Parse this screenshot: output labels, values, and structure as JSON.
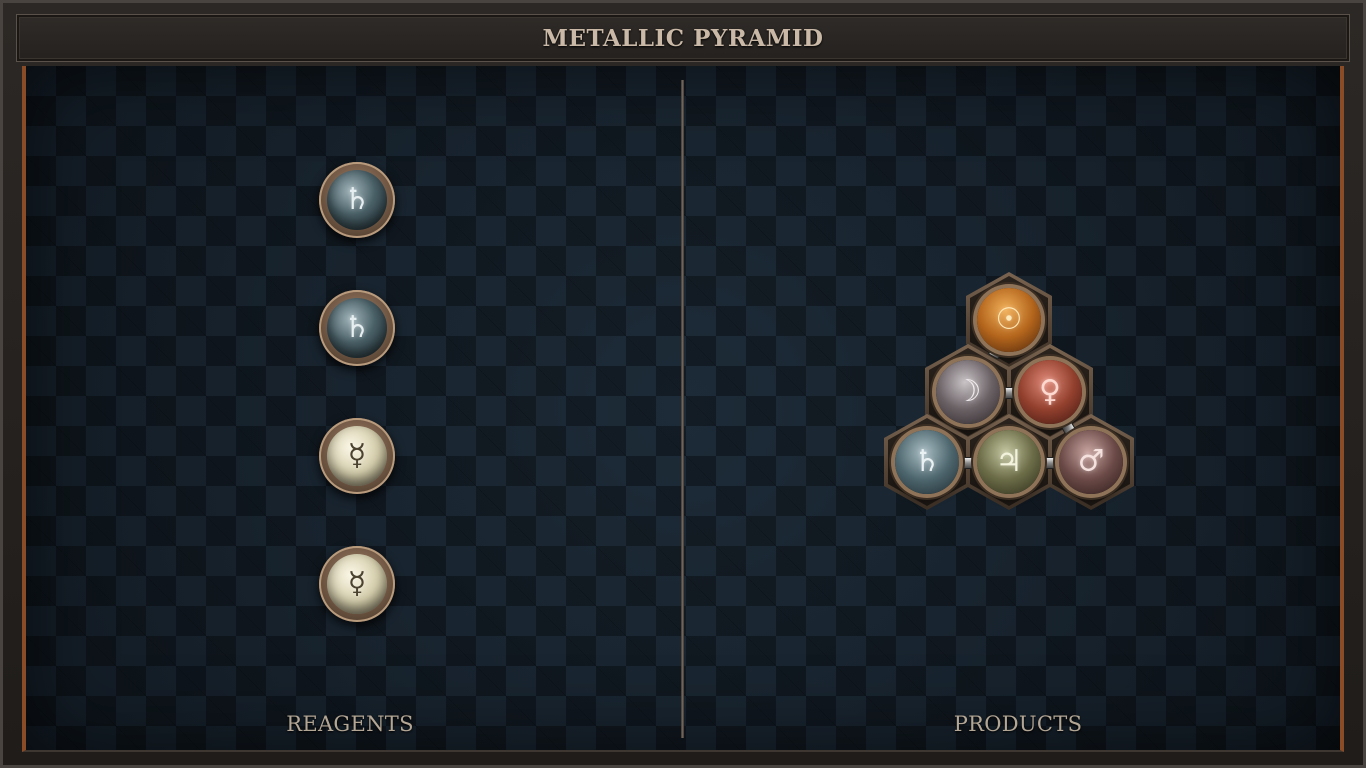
{
  "title": "METALLIC PYRAMID",
  "reagents_label": "REAGENTS",
  "products_label": "PRODUCTS",
  "reagents": [
    {
      "element": "lead",
      "symbol": "♄"
    },
    {
      "element": "lead",
      "symbol": "♄"
    },
    {
      "element": "quicksilver",
      "symbol": "☿"
    },
    {
      "element": "quicksilver",
      "symbol": "☿"
    }
  ],
  "product_atoms": [
    {
      "element": "gold",
      "symbol": "☉"
    },
    {
      "element": "silver",
      "symbol": "☽"
    },
    {
      "element": "copper",
      "symbol": "♀"
    },
    {
      "element": "lead",
      "symbol": "♄"
    },
    {
      "element": "tin",
      "symbol": "♃"
    },
    {
      "element": "iron",
      "symbol": "♂"
    }
  ],
  "colors": {
    "frame": "#2c2825",
    "board": "#16212c",
    "accent_copper": "#8a4c26",
    "label": "#b3a695"
  }
}
